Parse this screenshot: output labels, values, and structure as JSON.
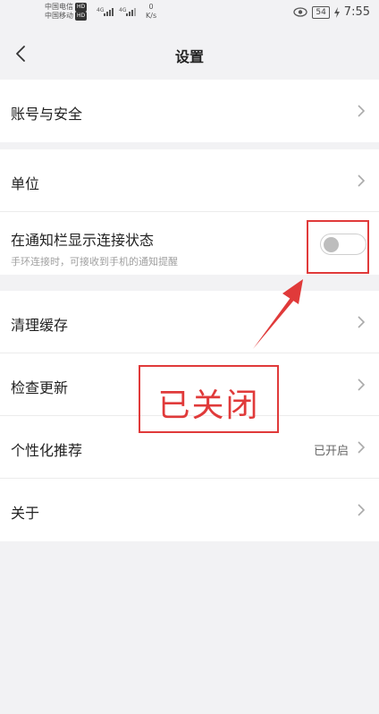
{
  "status_bar": {
    "carrier1": "中国电信",
    "carrier2": "中国移动",
    "hd": "HD",
    "signal1": "4G",
    "signal2": "4G",
    "speed_value": "0",
    "speed_unit": "K/s",
    "battery": "54",
    "time": "7:55"
  },
  "nav": {
    "title": "设置"
  },
  "section1": {
    "account_label": "账号与安全"
  },
  "section2": {
    "unit_label": "单位",
    "notify_label": "在通知栏显示连接状态",
    "notify_sub": "手环连接时，可接收到手机的通知提醒",
    "notify_toggle_on": false
  },
  "section3": {
    "clear_cache_label": "清理缓存",
    "check_update_label": "检查更新",
    "personalize_label": "个性化推荐",
    "personalize_value": "已开启",
    "about_label": "关于"
  },
  "annotation": {
    "text": "已关闭",
    "color": "#e03a3a"
  }
}
